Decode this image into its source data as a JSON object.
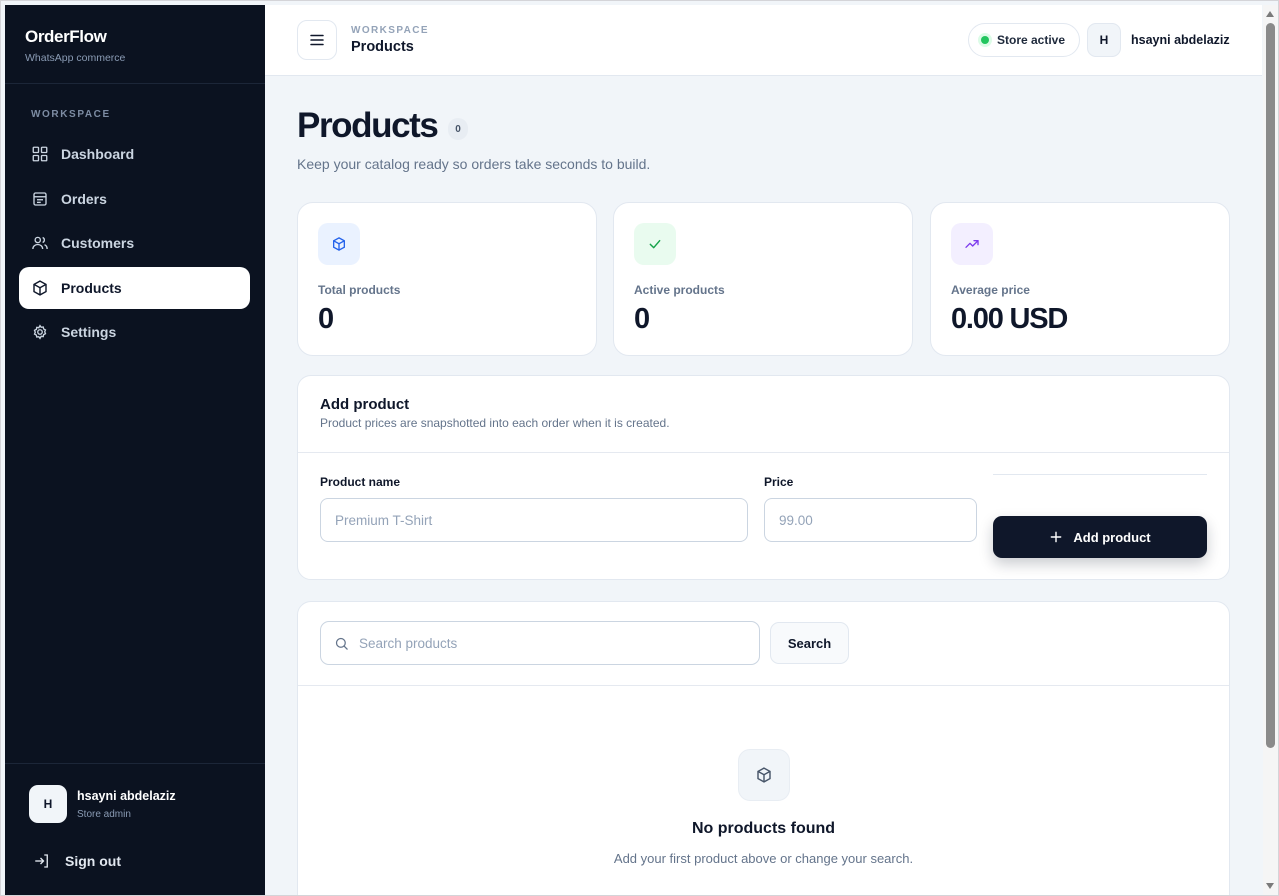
{
  "brand": {
    "name": "OrderFlow",
    "subtitle": "WhatsApp commerce"
  },
  "sidebar": {
    "section": "WORKSPACE",
    "items": [
      {
        "label": "Dashboard",
        "icon": "grid-icon",
        "active": false
      },
      {
        "label": "Orders",
        "icon": "orders-icon",
        "active": false
      },
      {
        "label": "Customers",
        "icon": "users-icon",
        "active": false
      },
      {
        "label": "Products",
        "icon": "box-icon",
        "active": true
      },
      {
        "label": "Settings",
        "icon": "gear-icon",
        "active": false
      }
    ],
    "user": {
      "initial": "H",
      "name": "hsayni abdelaziz",
      "role": "Store admin"
    },
    "signout": "Sign out"
  },
  "header": {
    "breadcrumb_top": "WORKSPACE",
    "breadcrumb_title": "Products",
    "store_status": "Store active",
    "user_initial": "H",
    "user_name": "hsayni abdelaziz"
  },
  "page": {
    "title": "Products",
    "count": "0",
    "subtitle": "Keep your catalog ready so orders take seconds to build."
  },
  "stats": [
    {
      "label": "Total products",
      "value": "0",
      "icon": "box-icon",
      "color": "#2563eb"
    },
    {
      "label": "Active products",
      "value": "0",
      "icon": "check-icon",
      "color": "#16a34a"
    },
    {
      "label": "Average price",
      "value": "0.00 USD",
      "icon": "trend-up-icon",
      "color": "#7c3aed"
    }
  ],
  "add_form": {
    "title": "Add product",
    "description": "Product prices are snapshotted into each order when it is created.",
    "name_label": "Product name",
    "name_placeholder": "Premium T-Shirt",
    "price_label": "Price",
    "price_placeholder": "99.00",
    "submit_label": "Add product"
  },
  "list": {
    "search_placeholder": "Search products",
    "search_button": "Search",
    "empty_title": "No products found",
    "empty_subtitle": "Add your first product above or change your search."
  },
  "colors": {
    "sidebar_bg": "#0b1220",
    "accent_dark": "#0f172a",
    "status_green": "#22c55e"
  }
}
